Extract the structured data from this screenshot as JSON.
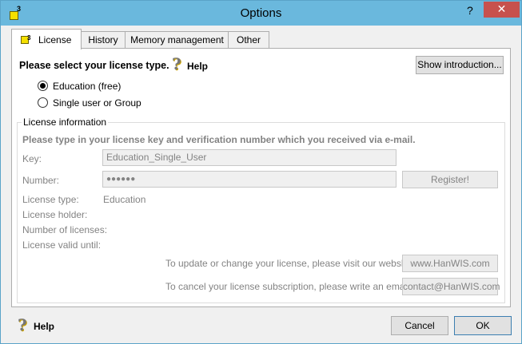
{
  "window": {
    "title": "Options",
    "help_glyph": "?",
    "close_glyph": "✕",
    "icon_sup": "3"
  },
  "tabs": [
    {
      "label": "License",
      "active": true
    },
    {
      "label": "History",
      "active": false
    },
    {
      "label": "Memory management",
      "active": false
    },
    {
      "label": "Other",
      "active": false
    }
  ],
  "license": {
    "select_heading": "Please select your license type.",
    "help_label": "Help",
    "show_intro_label": "Show introduction...",
    "options": [
      {
        "label": "Education (free)",
        "selected": true
      },
      {
        "label": "Single user or Group",
        "selected": false
      }
    ]
  },
  "info": {
    "group_title": "License information",
    "instruction": "Please type in your license key and verification number which you received via e-mail.",
    "key_label": "Key:",
    "key_value": "Education_Single_User",
    "number_label": "Number:",
    "number_value": "●●●●●●",
    "register_label": "Register!",
    "type_label": "License type:",
    "type_value": "Education",
    "holder_label": "License holder:",
    "count_label": "Number of licenses:",
    "valid_label": "License valid until:",
    "update_text": "To update or change your license, please visit our webshop:",
    "webshop_label": "www.HanWIS.com",
    "cancel_text": "To cancel your license subscription, please write an email to:",
    "email_label": "contact@HanWIS.com"
  },
  "footer": {
    "help_label": "Help",
    "cancel_label": "Cancel",
    "ok_label": "OK"
  },
  "colors": {
    "titlebar": "#6ab8dd",
    "close": "#c7514d",
    "help_icon_accent": "#c8a000"
  }
}
